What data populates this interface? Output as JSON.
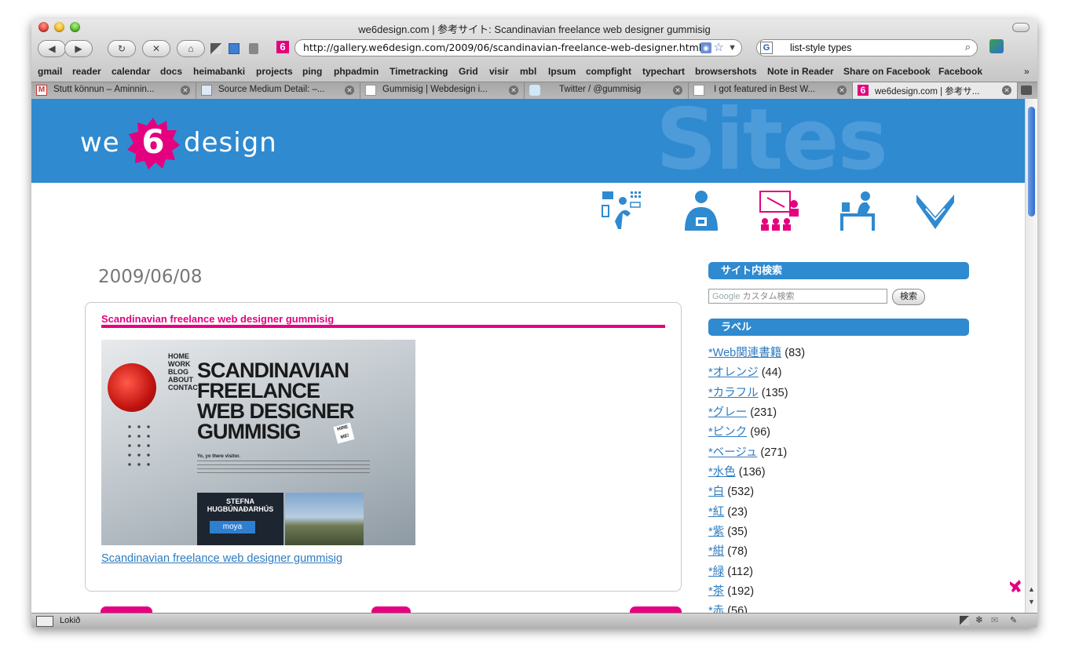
{
  "window": {
    "title": "we6design.com | 参考サイト: Scandinavian freelance web designer gummisig"
  },
  "toolbar": {
    "url": "http://gallery.we6design.com/2009/06/scandinavian-freelance-web-designer.html",
    "search_value": "list-style types",
    "favicon_glyph": "6"
  },
  "bookmarks": [
    "gmail",
    "reader",
    "calendar",
    "docs",
    "heimabanki",
    "projects",
    "ping",
    "phpadmin",
    "Timetracking",
    "Grid",
    "visir",
    "mbl",
    "Ipsum",
    "compfight",
    "typechart",
    "browsershots",
    "Note in Reader",
    "Share on Facebook",
    "Facebook"
  ],
  "tabs": [
    {
      "label": "Stutt könnun – Áminnin...",
      "icon": "gmail-icon"
    },
    {
      "label": "Source Medium Detail: –...",
      "icon": "analytics-icon"
    },
    {
      "label": "Gummisig | Webdesign i...",
      "icon": "page-icon"
    },
    {
      "label": "Twitter / @gummisig",
      "icon": "twitter-icon"
    },
    {
      "label": "I got featured in Best W...",
      "icon": "page-icon"
    },
    {
      "label": "we6design.com | 参考サ...",
      "icon": "we6-icon",
      "active": true
    }
  ],
  "site": {
    "logo_left": "we",
    "logo_number": "6",
    "logo_right": "design",
    "banner_watermark": "Sites",
    "nav_icons": [
      "designer-icon",
      "id-badge-icon",
      "presentation-icon",
      "desk-worker-icon",
      "handshake-icon"
    ]
  },
  "post": {
    "date": "2009/06/08",
    "title": "Scandinavian freelance web designer gummisig",
    "link_text": "Scandinavian freelance web designer gummisig",
    "screenshot": {
      "nav": [
        "HOME",
        "WORK",
        "BLOG",
        "ABOUT",
        "CONTACT"
      ],
      "headline": [
        "SCANDINAVIAN",
        "FREELANCE",
        "WEB DESIGNER",
        "GUMMISIG"
      ],
      "intro": "Yo, yo there visitor.",
      "sticker": "HIRE ME!",
      "panel_title": "STEFNA HUGBÚNAÐARHÚS",
      "panel_logo": "moya"
    }
  },
  "sidebar": {
    "search_heading": "サイト内検索",
    "search_placeholder": "カスタム検索",
    "search_brand": "Google",
    "search_button": "検索",
    "labels_heading": "ラベル",
    "labels": [
      {
        "name": "*Web関連書籍",
        "count": "(83)"
      },
      {
        "name": "*オレンジ",
        "count": "(44)"
      },
      {
        "name": "*カラフル",
        "count": "(135)"
      },
      {
        "name": "*グレー",
        "count": "(231)"
      },
      {
        "name": "*ピンク",
        "count": "(96)"
      },
      {
        "name": "*ベージュ",
        "count": "(271)"
      },
      {
        "name": "*水色",
        "count": "(136)"
      },
      {
        "name": "*白",
        "count": "(532)"
      },
      {
        "name": "*紅",
        "count": "(23)"
      },
      {
        "name": "*紫",
        "count": "(35)"
      },
      {
        "name": "*紺",
        "count": "(78)"
      },
      {
        "name": "*緑",
        "count": "(112)"
      },
      {
        "name": "*茶",
        "count": "(192)"
      },
      {
        "name": "*赤",
        "count": "(56)"
      }
    ]
  },
  "status": {
    "text": "Lokið"
  },
  "colors": {
    "brand_blue": "#2f8ad0",
    "brand_pink": "#e4007f",
    "link": "#2e7bbf"
  }
}
